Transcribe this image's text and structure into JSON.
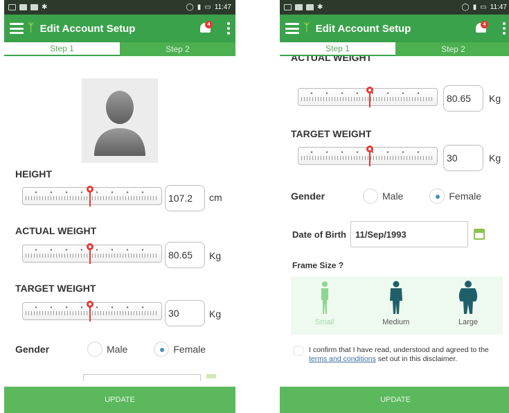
{
  "screens": [
    {
      "statusbar": {
        "time": "11:47"
      },
      "appbar": {
        "title": "Edit Account Setup",
        "notification_count": "4",
        "menu_icon": "hamburger-icon",
        "logo_icon": "runner-icon",
        "bell_icon": "bell-icon",
        "overflow_icon": "more-vert-icon"
      },
      "tabs": [
        {
          "label": "Step 1",
          "active": true
        },
        {
          "label": "Step 2",
          "active": false
        }
      ],
      "height": {
        "label": "HEIGHT",
        "value": "107.2",
        "unit": "cm"
      },
      "actual_weight": {
        "label": "ACTUAL WEIGHT",
        "value": "80.65",
        "unit": "Kg"
      },
      "target_weight": {
        "label": "TARGET WEIGHT",
        "value": "30",
        "unit": "Kg"
      },
      "gender": {
        "label": "Gender",
        "options": [
          "Male",
          "Female"
        ],
        "selected": "Female"
      },
      "update_label": "UPDATE"
    },
    {
      "statusbar": {
        "time": "11:47"
      },
      "appbar": {
        "title": "Edit Account Setup",
        "notification_count": "4"
      },
      "tabs": [
        {
          "label": "Step 1",
          "active": true
        },
        {
          "label": "Step 2",
          "active": false
        }
      ],
      "actual_weight": {
        "label": "ACTUAL WEIGHT",
        "value": "80.65",
        "unit": "Kg"
      },
      "target_weight": {
        "label": "TARGET WEIGHT",
        "value": "30",
        "unit": "Kg"
      },
      "gender": {
        "label": "Gender",
        "options": [
          "Male",
          "Female"
        ],
        "selected": "Female"
      },
      "dob": {
        "label": "Date of Birth",
        "value": "11/Sep/1993"
      },
      "frame_size": {
        "label": "Frame Size ?",
        "options": [
          "Small",
          "Medium",
          "Large"
        ],
        "selected": "Small"
      },
      "confirm": {
        "text_before": "I confirm that I have read, understood and agreed to the ",
        "link": "terms and conditions",
        "text_after": " set out in this disclaimer."
      },
      "update_label": "UPDATE"
    }
  ],
  "colors": {
    "primary": "#3aa24a",
    "update_bar": "#5cb85c",
    "marker": "#e53935",
    "frame_selected": "#8fd68f",
    "frame_unselected": "#1f5f6a"
  }
}
